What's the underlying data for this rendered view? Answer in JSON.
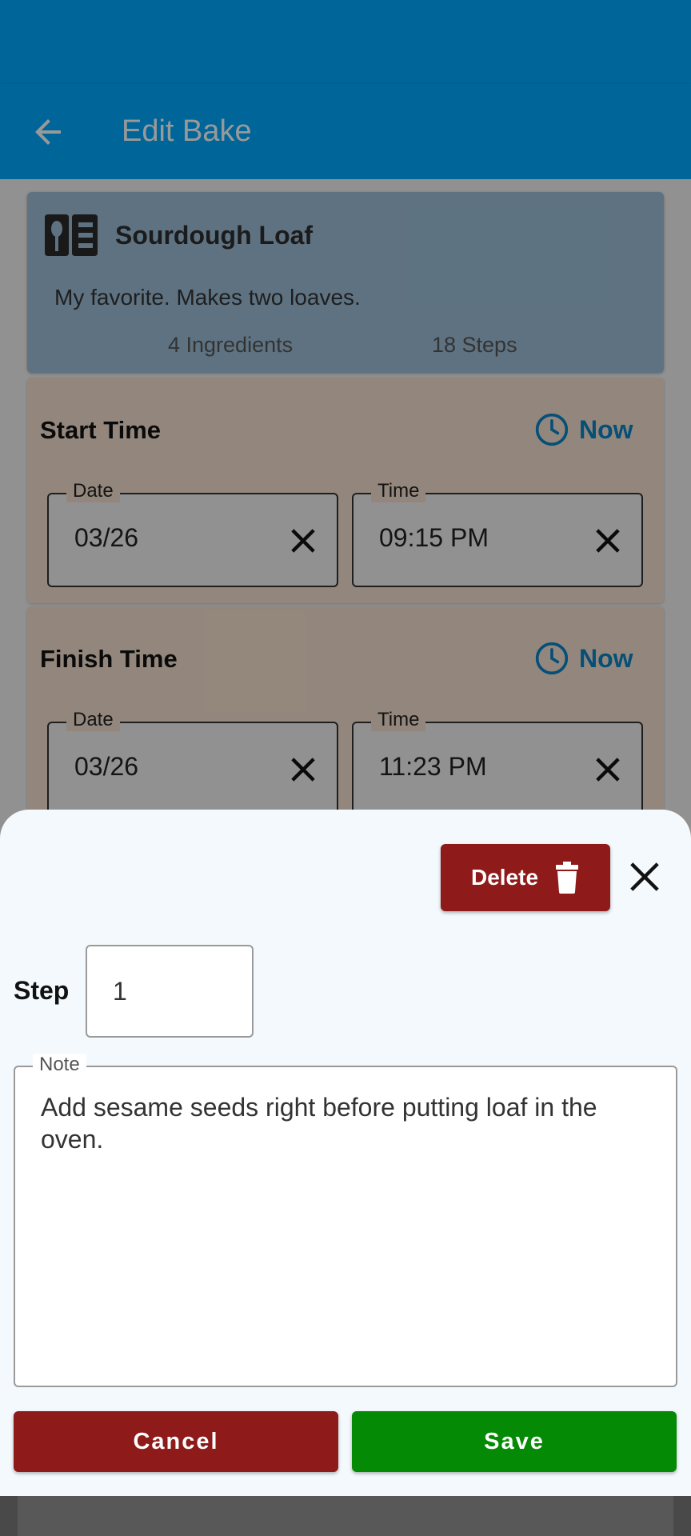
{
  "app_bar": {
    "title": "Edit Bake",
    "back_icon": "arrow-left-icon",
    "color": "#00aaff"
  },
  "recipe": {
    "name": "Sourdough Loaf",
    "description": "My favorite. Makes two loaves.",
    "ingredients": "4 Ingredients",
    "steps": "18 Steps",
    "icon": "recipe-book-icon"
  },
  "start_time": {
    "title": "Start Time",
    "now_label": "Now",
    "date_label": "Date",
    "date_value": "03/26",
    "time_label": "Time",
    "time_value": "09:15 PM"
  },
  "finish_time": {
    "title": "Finish Time",
    "now_label": "Now",
    "date_label": "Date",
    "date_value": "03/26",
    "time_label": "Time",
    "time_value": "11:23 PM"
  },
  "sheet": {
    "delete_label": "Delete",
    "step_label": "Step",
    "step_value": "1",
    "note_label": "Note",
    "note_text": "Add sesame seeds right before putting loaf in the oven.",
    "cancel_label": "Cancel",
    "save_label": "Save"
  },
  "colors": {
    "danger": "#8e1a1a",
    "success": "#058a05",
    "accent": "#0a84c6"
  }
}
